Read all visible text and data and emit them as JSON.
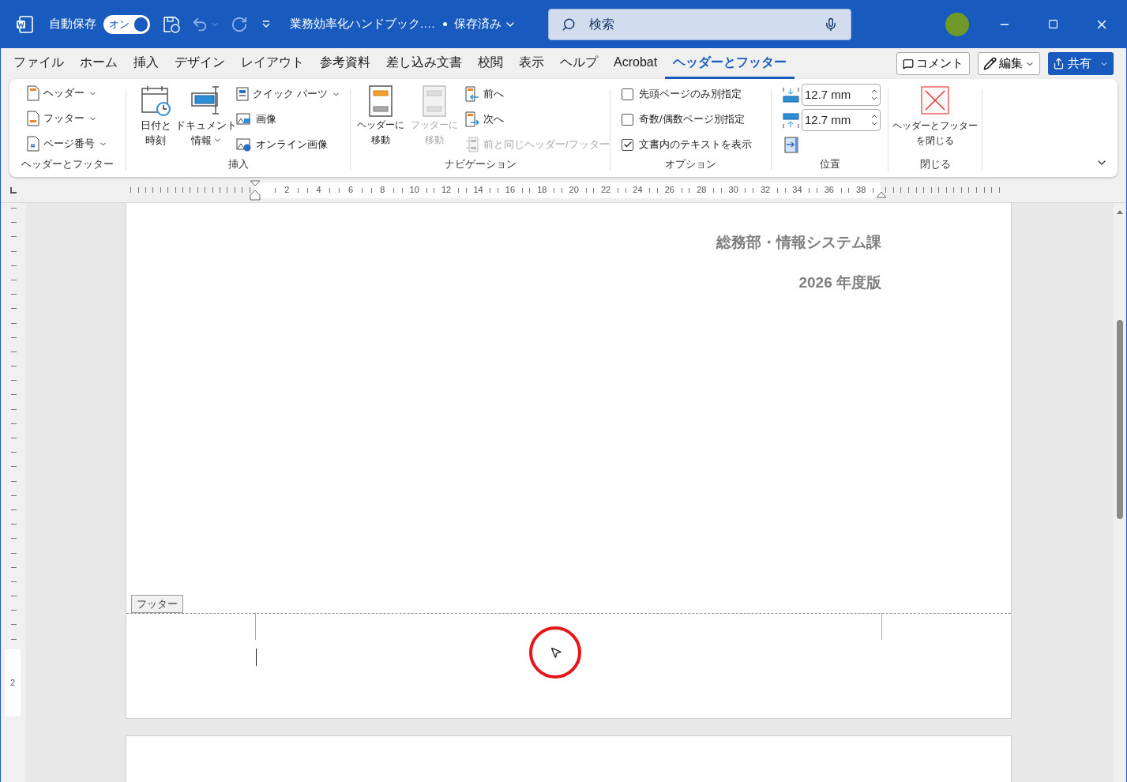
{
  "title_bar": {
    "autosave_label": "自動保存",
    "autosave_toggle": {
      "label": "オン",
      "on": true
    },
    "document_title": "業務効率化ハンドブック.…",
    "save_status": "保存済み",
    "search": {
      "placeholder": "検索"
    }
  },
  "menu_tabs": [
    {
      "label": "ファイル",
      "selected": false
    },
    {
      "label": "ホーム",
      "selected": false
    },
    {
      "label": "挿入",
      "selected": false
    },
    {
      "label": "デザイン",
      "selected": false
    },
    {
      "label": "レイアウト",
      "selected": false
    },
    {
      "label": "参考資料",
      "selected": false
    },
    {
      "label": "差し込み文書",
      "selected": false
    },
    {
      "label": "校閲",
      "selected": false
    },
    {
      "label": "表示",
      "selected": false
    },
    {
      "label": "ヘルプ",
      "selected": false
    },
    {
      "label": "Acrobat",
      "selected": false
    },
    {
      "label": "ヘッダーとフッター",
      "selected": true
    }
  ],
  "actions": {
    "comment": "コメント",
    "edit": "編集",
    "share": "共有"
  },
  "ribbon": {
    "header_footer": {
      "label": "ヘッダーとフッター",
      "items": [
        {
          "label": "ヘッダー",
          "kind": "header"
        },
        {
          "label": "フッター",
          "kind": "footer"
        },
        {
          "label": "ページ番号",
          "kind": "page"
        }
      ]
    },
    "insert": {
      "label": "挿入",
      "large": [
        {
          "lines": [
            "日付と",
            "時刻"
          ],
          "kind": "date",
          "dropdown": false
        },
        {
          "lines": [
            "ドキュメント",
            "情報"
          ],
          "kind": "docinfo",
          "dropdown": true
        }
      ],
      "small": [
        {
          "label": "クイック パーツ",
          "kind": "parts",
          "dropdown": true
        },
        {
          "label": "画像",
          "kind": "image",
          "dropdown": false
        },
        {
          "label": "オンライン画像",
          "kind": "online",
          "dropdown": false
        }
      ]
    },
    "navigation": {
      "label": "ナビゲーション",
      "large": [
        {
          "lines": [
            "ヘッダーに",
            "移動"
          ],
          "disabled": false
        },
        {
          "lines": [
            "フッターに",
            "移動"
          ],
          "disabled": true
        }
      ],
      "small": [
        {
          "label": "前へ",
          "kind": "prev",
          "disabled": false
        },
        {
          "label": "次へ",
          "kind": "next",
          "disabled": false
        },
        {
          "label": "前と同じヘッダー/フッター",
          "kind": "link",
          "disabled": true
        }
      ]
    },
    "options": {
      "label": "オプション",
      "checkboxes": [
        {
          "label": "先頭ページのみ別指定",
          "checked": false
        },
        {
          "label": "奇数/偶数ページ別指定",
          "checked": false
        },
        {
          "label": "文書内のテキストを表示",
          "checked": true
        }
      ]
    },
    "position": {
      "label": "位置",
      "spinners": [
        {
          "value": "12.7 mm",
          "kind": "top"
        },
        {
          "value": "12.7 mm",
          "kind": "bottom"
        }
      ]
    },
    "close": {
      "label": "閉じる",
      "button": [
        "ヘッダーとフッター",
        "を閉じる"
      ]
    }
  },
  "ruler": {
    "labels": [
      "2",
      "4",
      "6",
      "8",
      "10",
      "12",
      "14",
      "16",
      "18",
      "20",
      "22",
      "24",
      "26",
      "28",
      "30",
      "32",
      "34",
      "36",
      "38"
    ],
    "vertical_label": "2"
  },
  "document": {
    "header_lines": [
      "総務部・情報システム課",
      "2026 年度版"
    ],
    "footer_tag": "フッター"
  }
}
